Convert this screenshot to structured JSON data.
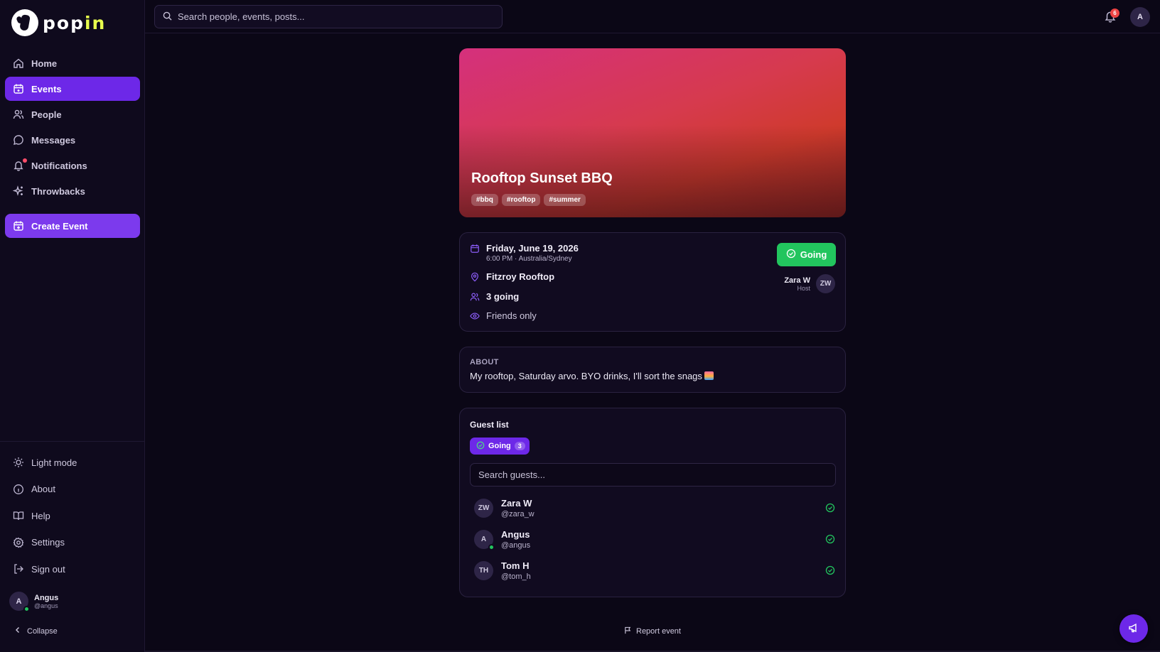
{
  "app": {
    "logo_text_a": "pop",
    "logo_text_b": "in"
  },
  "sidebar": {
    "items": [
      {
        "label": "Home",
        "icon": "home-icon"
      },
      {
        "label": "Events",
        "icon": "calendar-icon",
        "active": true
      },
      {
        "label": "People",
        "icon": "users-icon"
      },
      {
        "label": "Messages",
        "icon": "message-icon"
      },
      {
        "label": "Notifications",
        "icon": "bell-icon",
        "has_dot": true
      },
      {
        "label": "Throwbacks",
        "icon": "sparkles-icon"
      }
    ],
    "create_label": "Create Event",
    "bottom": [
      {
        "label": "Light mode",
        "icon": "sun-icon"
      },
      {
        "label": "About",
        "icon": "info-icon"
      },
      {
        "label": "Help",
        "icon": "book-icon"
      },
      {
        "label": "Settings",
        "icon": "gear-icon"
      },
      {
        "label": "Sign out",
        "icon": "logout-icon"
      }
    ],
    "user": {
      "initial": "A",
      "name": "Angus",
      "handle": "@angus"
    },
    "collapse_label": "Collapse"
  },
  "topbar": {
    "search_placeholder": "Search people, events, posts...",
    "notif_count": "6",
    "avatar_initial": "A"
  },
  "event": {
    "title": "Rooftop Sunset BBQ",
    "tags": [
      "#bbq",
      "#rooftop",
      "#summer"
    ],
    "date": "Friday, June 19, 2026",
    "time": "6:00 PM · Australia/Sydney",
    "location": "Fitzroy Rooftop",
    "going_count": "3 going",
    "visibility": "Friends only",
    "rsvp_label": "Going",
    "host": {
      "name": "Zara W",
      "role": "Host",
      "initials": "ZW"
    },
    "about_label": "ABOUT",
    "about_text": "My rooftop, Saturday arvo. BYO drinks, I'll sort the snags"
  },
  "guests": {
    "title": "Guest list",
    "filter_label": "Going",
    "filter_count": "3",
    "search_placeholder": "Search guests...",
    "list": [
      {
        "initials": "ZW",
        "name": "Zara W",
        "handle": "@zara_w",
        "online": false
      },
      {
        "initials": "A",
        "name": "Angus",
        "handle": "@angus",
        "online": true
      },
      {
        "initials": "TH",
        "name": "Tom H",
        "handle": "@tom_h",
        "online": false
      }
    ]
  },
  "report_label": "Report event",
  "colors": {
    "accent": "#6d28e8",
    "going": "#22c55e",
    "background": "#0b0716"
  }
}
